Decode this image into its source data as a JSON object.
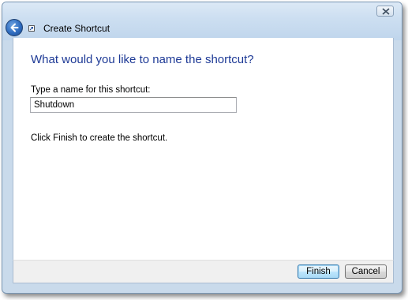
{
  "window": {
    "title": "Create Shortcut"
  },
  "icons": {
    "back": "back-arrow-icon",
    "close": "close-x-icon",
    "shortcut": "shortcut-icon"
  },
  "main": {
    "heading": "What would you like to name the shortcut?",
    "name_label": "Type a name for this shortcut:",
    "name_value": "Shutdown",
    "instruction": "Click Finish to create the shortcut."
  },
  "footer": {
    "finish_label": "Finish",
    "cancel_label": "Cancel"
  },
  "colors": {
    "heading": "#1e3a96",
    "frame": "#c9daeb",
    "default_button": "#bee6fd"
  }
}
